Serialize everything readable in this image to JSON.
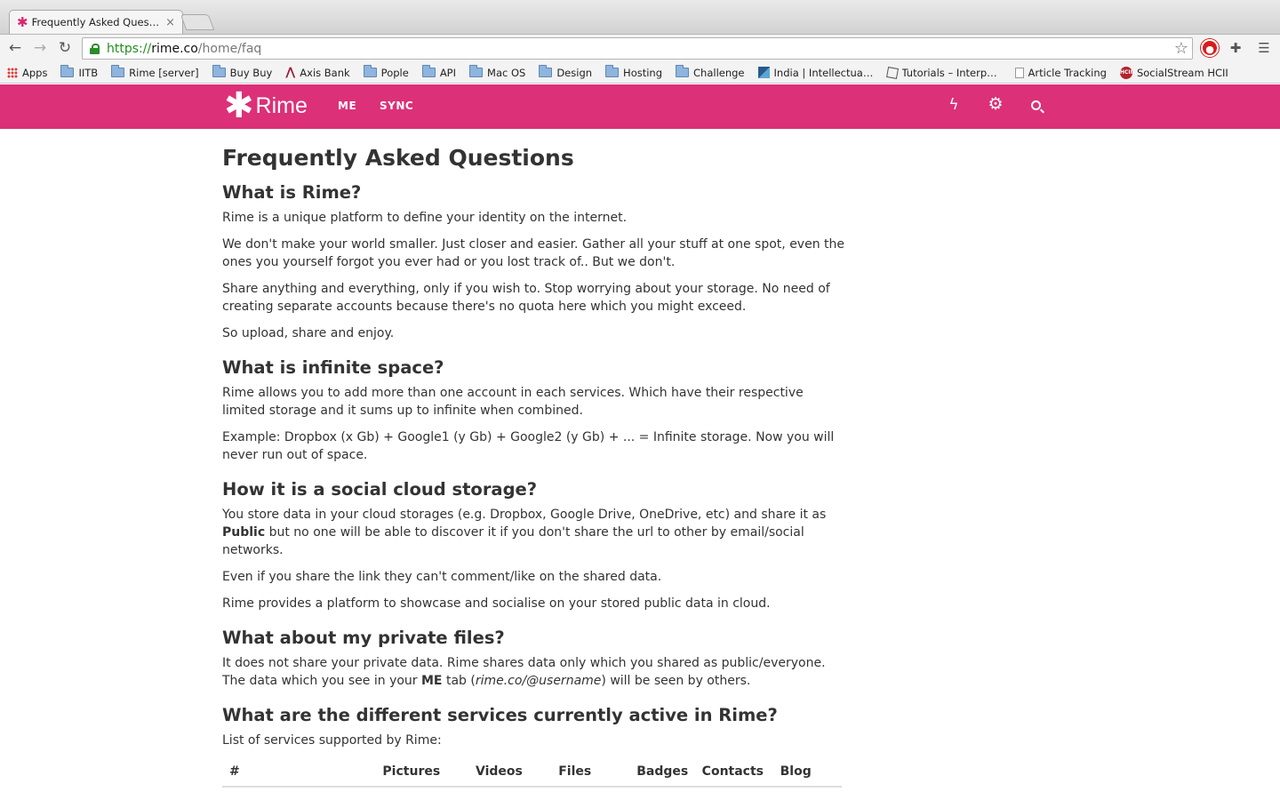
{
  "browser": {
    "tab_title": "Frequently Asked Questions",
    "tab_close": "×",
    "url_scheme": "https://",
    "url_host": "rime.co",
    "url_path": "/home/faq",
    "bookmarks": [
      {
        "label": "Apps",
        "icon": "apps-grid-icon"
      },
      {
        "label": "IITB",
        "icon": "folder-icon"
      },
      {
        "label": "Rime [server]",
        "icon": "folder-icon"
      },
      {
        "label": "Buy Buy",
        "icon": "folder-icon"
      },
      {
        "label": "Axis Bank",
        "icon": "axis-bank-icon"
      },
      {
        "label": "Pople",
        "icon": "folder-icon"
      },
      {
        "label": "API",
        "icon": "folder-icon"
      },
      {
        "label": "Mac OS",
        "icon": "folder-icon"
      },
      {
        "label": "Design",
        "icon": "folder-icon"
      },
      {
        "label": "Hosting",
        "icon": "folder-icon"
      },
      {
        "label": "Challenge",
        "icon": "folder-icon"
      },
      {
        "label": "India | Intellectual V",
        "icon": "site-favicon-icon"
      },
      {
        "label": "Tutorials – Interpola",
        "icon": "tutorials-icon"
      },
      {
        "label": "Article Tracking",
        "icon": "page-icon"
      },
      {
        "label": "SocialStream HCII",
        "icon": "hcii-icon"
      }
    ]
  },
  "header": {
    "brand": "Rime",
    "nav": [
      "ME",
      "SYNC"
    ],
    "brand_color": "#dc3078"
  },
  "faq": {
    "title": "Frequently Asked Questions",
    "q1": {
      "title": "What is Rime?",
      "p1": "Rime is a unique platform to define your identity on the internet.",
      "p2": "We don't make your world smaller. Just closer and easier. Gather all your stuff at one spot, even the ones you yourself forgot you ever had or you lost track of.. But we don't.",
      "p3": "Share anything and everything, only if you wish to. Stop worrying about your storage. No need of creating separate accounts because there's no quota here which you might exceed.",
      "p4": "So upload, share and enjoy."
    },
    "q2": {
      "title": "What is infinite space?",
      "p1": "Rime allows you to add more than one account in each services. Which have their respective limited storage and it sums up to infinite when combined.",
      "p2": "Example: Dropbox (x Gb) + Google1 (y Gb) + Google2 (y Gb) + ... = Infinite storage. Now you will never run out of space."
    },
    "q3": {
      "title": "How it is a social cloud storage?",
      "p1_a": "You store data in your cloud storages (e.g. Dropbox, Google Drive, OneDrive, etc) and share it as ",
      "p1_bold": "Public",
      "p1_b": " but no one will be able to discover it if you don't share the url to other by email/social networks.",
      "p2": "Even if you share the link they can't comment/like on the shared data.",
      "p3": "Rime provides a platform to showcase and socialise on your stored public data in cloud."
    },
    "q4": {
      "title": "What about my private files?",
      "p1_a": "It does not share your private data. Rime shares data only which you shared as public/everyone. The data which you see in your ",
      "p1_bold": "ME",
      "p1_b": " tab (",
      "p1_italic": "rime.co/@username",
      "p1_c": ") will be seen by others."
    },
    "q5": {
      "title": "What are the different services currently active in Rime?",
      "p1": "List of services supported by Rime:",
      "table_headers": [
        "#",
        "Pictures",
        "Videos",
        "Files",
        "Badges",
        "Contacts",
        "Blog"
      ]
    }
  }
}
